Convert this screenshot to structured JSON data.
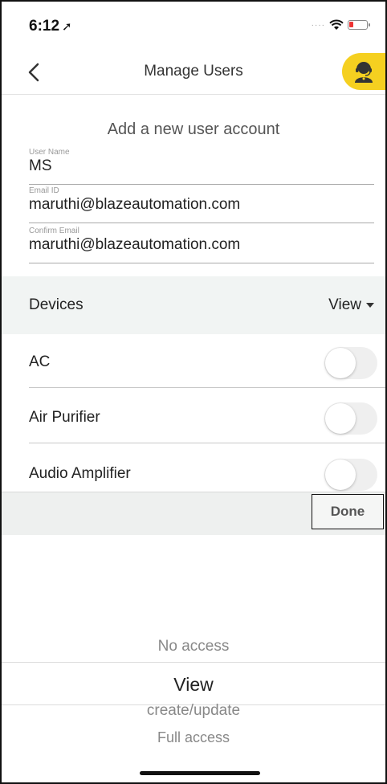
{
  "status_bar": {
    "time": "6:12",
    "location_icon": "location-arrow-icon",
    "signal_icon": "signal-dots-icon",
    "wifi_icon": "wifi-icon",
    "battery_icon": "battery-low-icon"
  },
  "nav": {
    "title": "Manage Users",
    "back_icon": "chevron-left-icon",
    "support_icon": "support-agent-icon"
  },
  "form": {
    "title": "Add a new user account",
    "fields": [
      {
        "label": "User Name",
        "value": "MS"
      },
      {
        "label": "Email ID",
        "value": "maruthi@blazeautomation.com"
      },
      {
        "label": "Confirm Email",
        "value": "maruthi@blazeautomation.com"
      }
    ]
  },
  "devices": {
    "header_label": "Devices",
    "view_label": "View",
    "items": [
      {
        "name": "AC",
        "enabled": false
      },
      {
        "name": "Air Purifier",
        "enabled": false
      },
      {
        "name": "Audio Amplifier",
        "enabled": false
      }
    ]
  },
  "picker": {
    "done_label": "Done",
    "options": [
      "No access",
      "View",
      "create/update",
      "Full access"
    ],
    "selected": "View"
  },
  "colors": {
    "accent": "#f5d020",
    "header_bg": "#f1f4f3",
    "battery_low": "#e33333"
  }
}
